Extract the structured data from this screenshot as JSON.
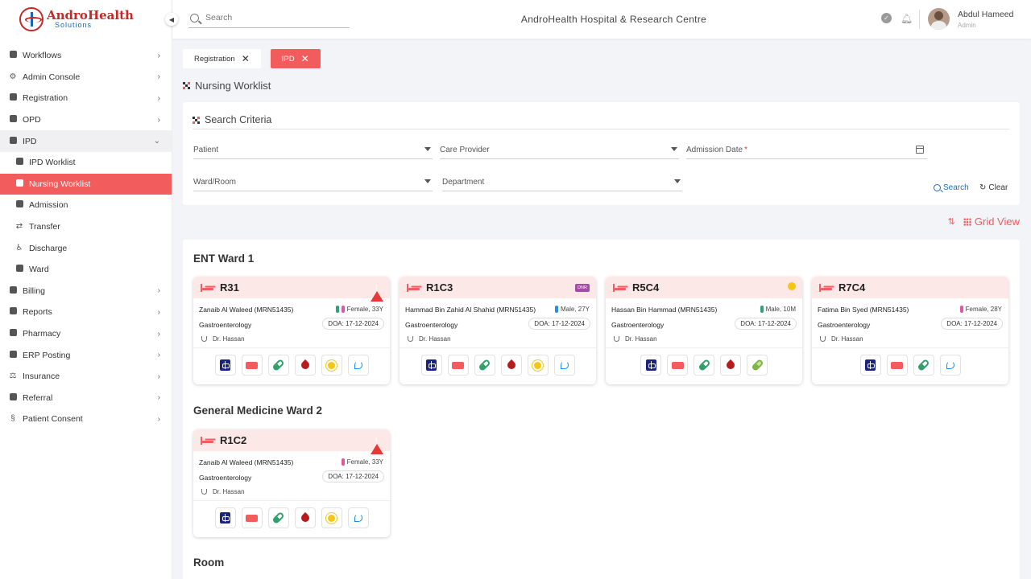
{
  "logo": {
    "title": "AndroHealth",
    "subtitle": "Solutions"
  },
  "header": {
    "search_placeholder": "Search",
    "hospital": "AndroHealth Hospital & Research Centre",
    "user_name": "Abdul Hameed",
    "user_role": "Admin"
  },
  "sidebar": {
    "items": [
      {
        "label": "Workflows",
        "icon": "monitor-icon"
      },
      {
        "label": "Admin Console",
        "icon": "gear-icon"
      },
      {
        "label": "Registration",
        "icon": "check-square-icon"
      },
      {
        "label": "OPD",
        "icon": "building-icon"
      },
      {
        "label": "IPD",
        "icon": "bed-icon"
      },
      {
        "label": "IPD Worklist",
        "icon": "clipboard-icon"
      },
      {
        "label": "Nursing Worklist",
        "icon": "nurse-icon"
      },
      {
        "label": "Admission",
        "icon": "admission-icon"
      },
      {
        "label": "Transfer",
        "icon": "transfer-icon"
      },
      {
        "label": "Discharge",
        "icon": "wheelchair-icon"
      },
      {
        "label": "Ward",
        "icon": "ward-bed-icon"
      },
      {
        "label": "Billing",
        "icon": "wallet-icon"
      },
      {
        "label": "Reports",
        "icon": "report-icon"
      },
      {
        "label": "Pharmacy",
        "icon": "pharmacy-icon"
      },
      {
        "label": "ERP Posting",
        "icon": "erp-icon"
      },
      {
        "label": "Insurance",
        "icon": "insurance-icon"
      },
      {
        "label": "Referral",
        "icon": "referral-icon"
      },
      {
        "label": "Patient Consent",
        "icon": "consent-icon"
      }
    ]
  },
  "tabs": [
    {
      "label": "Registration"
    },
    {
      "label": "IPD"
    }
  ],
  "page_title": "Nursing Worklist",
  "criteria": {
    "title": "Search Criteria",
    "patient": "Patient",
    "care_provider": "Care Provider",
    "admission_date": "Admission Date",
    "required_mark": "*",
    "ward_room": "Ward/Room",
    "department": "Department",
    "search_btn": "Search",
    "clear_btn": "Clear"
  },
  "view": {
    "label": "Grid View"
  },
  "wards": [
    {
      "title": "ENT Ward 1"
    },
    {
      "title": "General Medicine Ward 2"
    },
    {
      "title": "Room"
    }
  ],
  "cards": [
    {
      "room": "R31",
      "status": "alert",
      "name": "Zanaib Al Waleed (MRN51435)",
      "gender": "Female,  33Y",
      "dept": "Gastroenterology",
      "doa": "DOA: 17-12-2024",
      "doctor": "Dr. Hassan"
    },
    {
      "room": "R1C3",
      "status": "dnr",
      "status_label": "DNR",
      "name": "Hammad Bin Zahid Al Shahid (MRN51435)",
      "gender": "Male,  27Y",
      "dept": "Gastroenterology",
      "doa": "DOA: 17-12-2024",
      "doctor": "Dr. Hassan"
    },
    {
      "room": "R5C4",
      "status": "sun",
      "name": "Hassan Bin Hammad (MRN51435)",
      "gender": "Male,  10M",
      "dept": "Gastroenterology",
      "doa": "DOA: 17-12-2024",
      "doctor": "Dr. Hassan"
    },
    {
      "room": "R7C4",
      "status": "none",
      "name": "Fatima Bin Syed (MRN51435)",
      "gender": "Female,  28Y",
      "dept": "Gastroenterology",
      "doa": "DOA: 17-12-2024",
      "doctor": "Dr. Hassan"
    },
    {
      "room": "R1C2",
      "status": "alert",
      "name": "Zanaib Al Waleed (MRN51435)",
      "gender": "Female,  33Y",
      "dept": "Gastroenterology",
      "doa": "DOA: 17-12-2024",
      "doctor": "Dr. Hassan"
    }
  ],
  "colors": {
    "accent": "#f25c5c",
    "link": "#1f6fb2",
    "alert": "#e53935"
  }
}
